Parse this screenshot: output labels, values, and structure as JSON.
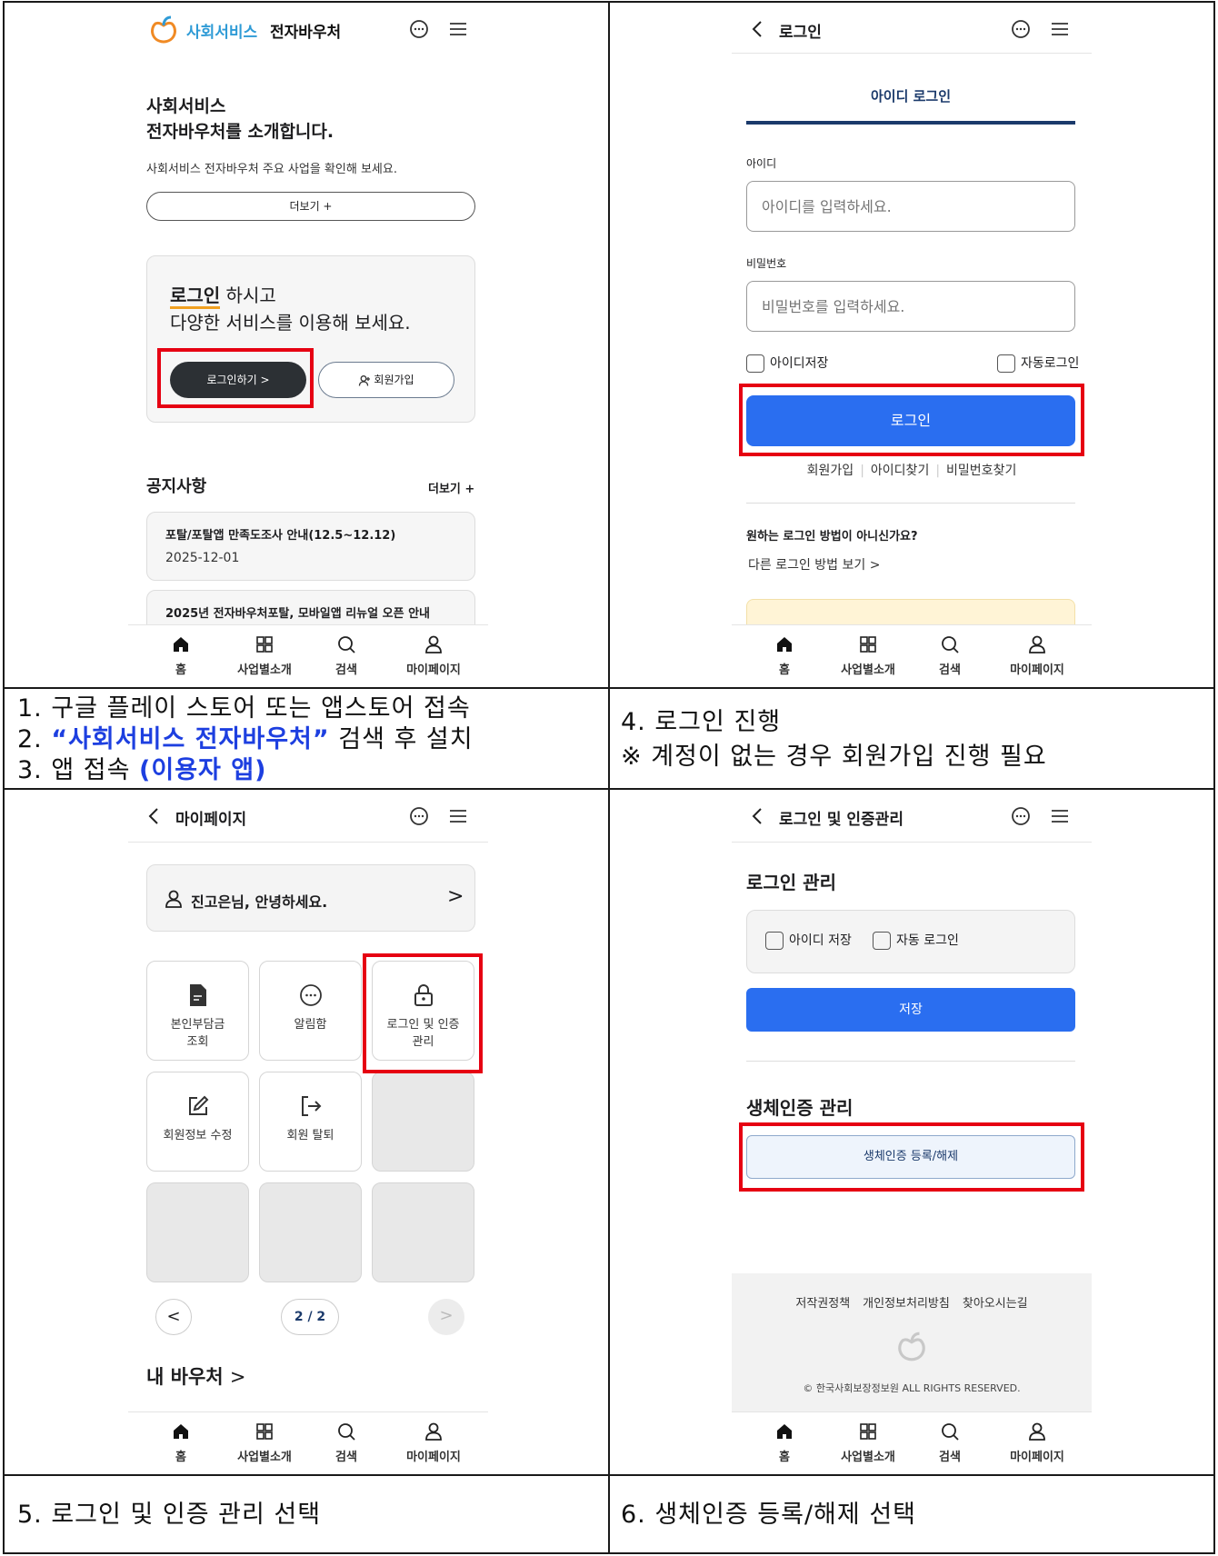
{
  "screen1": {
    "brand_blue": "사회서비스",
    "brand_dark": "전자바우처",
    "intro_line1": "사회서비스",
    "intro_line2": "전자바우처를 소개합니다.",
    "intro_desc": "사회서비스 전자바우처 주요 사업을 확인해 보세요.",
    "more_button": "더보기 +",
    "login_highlight": "로그인",
    "login_text1": " 하시고",
    "login_text2": "다양한 서비스를 이용해 보세요.",
    "login_button": "로그인하기 >",
    "signup_button": "회원가입",
    "notice_title": "공지사항",
    "notice_more": "더보기 +",
    "notices": [
      {
        "title": "포탈/포탈앱 만족도조사 안내(12.5~12.12)",
        "date": "2025-12-01"
      },
      {
        "title": "2025년 전자바우처포탈, 모바일앱 리뉴얼 오픈 안내",
        "date": ""
      }
    ]
  },
  "screen2": {
    "title": "로그인",
    "tab": "아이디 로그인",
    "id_label": "아이디",
    "id_placeholder": "아이디를 입력하세요.",
    "pw_label": "비밀번호",
    "pw_placeholder": "비밀번호를 입력하세요.",
    "save_id": "아이디저장",
    "auto_login": "자동로그인",
    "login_button": "로그인",
    "link_signup": "회원가입",
    "link_findid": "아이디찾기",
    "link_findpw": "비밀번호찾기",
    "alt_title": "원하는 로그인 방법이 아니신가요?",
    "alt_link": "다른 로그인 방법 보기"
  },
  "screen3": {
    "title": "마이페이지",
    "greeting": "진고은님, 안녕하세요.",
    "tiles": [
      "본인부담금\n조회",
      "알림함",
      "로그인 및 인증\n관리",
      "회원정보 수정",
      "회원 탈퇴"
    ],
    "tile_1a": "본인부담금",
    "tile_1b": "조회",
    "tile_2": "알림함",
    "tile_3a": "로그인 및 인증",
    "tile_3b": "관리",
    "tile_4": "회원정보 수정",
    "tile_5": "회원 탈퇴",
    "pager": "2 / 2",
    "voucher": "내 바우처"
  },
  "screen4": {
    "title": "로그인 및 인증관리",
    "login_mgmt": "로그인 관리",
    "save_id": "아이디 저장",
    "auto_login": "자동 로그인",
    "save_button": "저장",
    "bio_title": "생체인증 관리",
    "bio_button": "생체인증 등록/해제",
    "footer_links": [
      "저작권정책",
      "개인정보처리방침",
      "찾아오시는길"
    ],
    "copyright": "© 한국사회보장정보원 ALL RIGHTS RESERVED."
  },
  "nav": {
    "home": "홈",
    "business": "사업별소개",
    "search": "검색",
    "mypage": "마이페이지"
  },
  "steps": {
    "s1": "1. 구글 플레이 스토어 또는 앱스토어 접속",
    "s2_num": "2. ",
    "s2_blue": "“사회서비스 전자바우처”",
    "s2_rest": " 검색 후 설치",
    "s3_pre": "3. 앱 접속 ",
    "s3_blue": "(이용자 앱)",
    "s4": "4. 로그인 진행",
    "s4_note": "※ 계정이 없는 경우 회원가입 진행 필요",
    "s5": "5. 로그인 및 인증 관리 선택",
    "s6": "6. 생체인증 등록/해제 선택"
  },
  "colors": {
    "primary_blue": "#2a6ef0",
    "navy": "#1b3a6b",
    "brand_blue": "#2f9bd6",
    "highlight": "#e60012"
  }
}
